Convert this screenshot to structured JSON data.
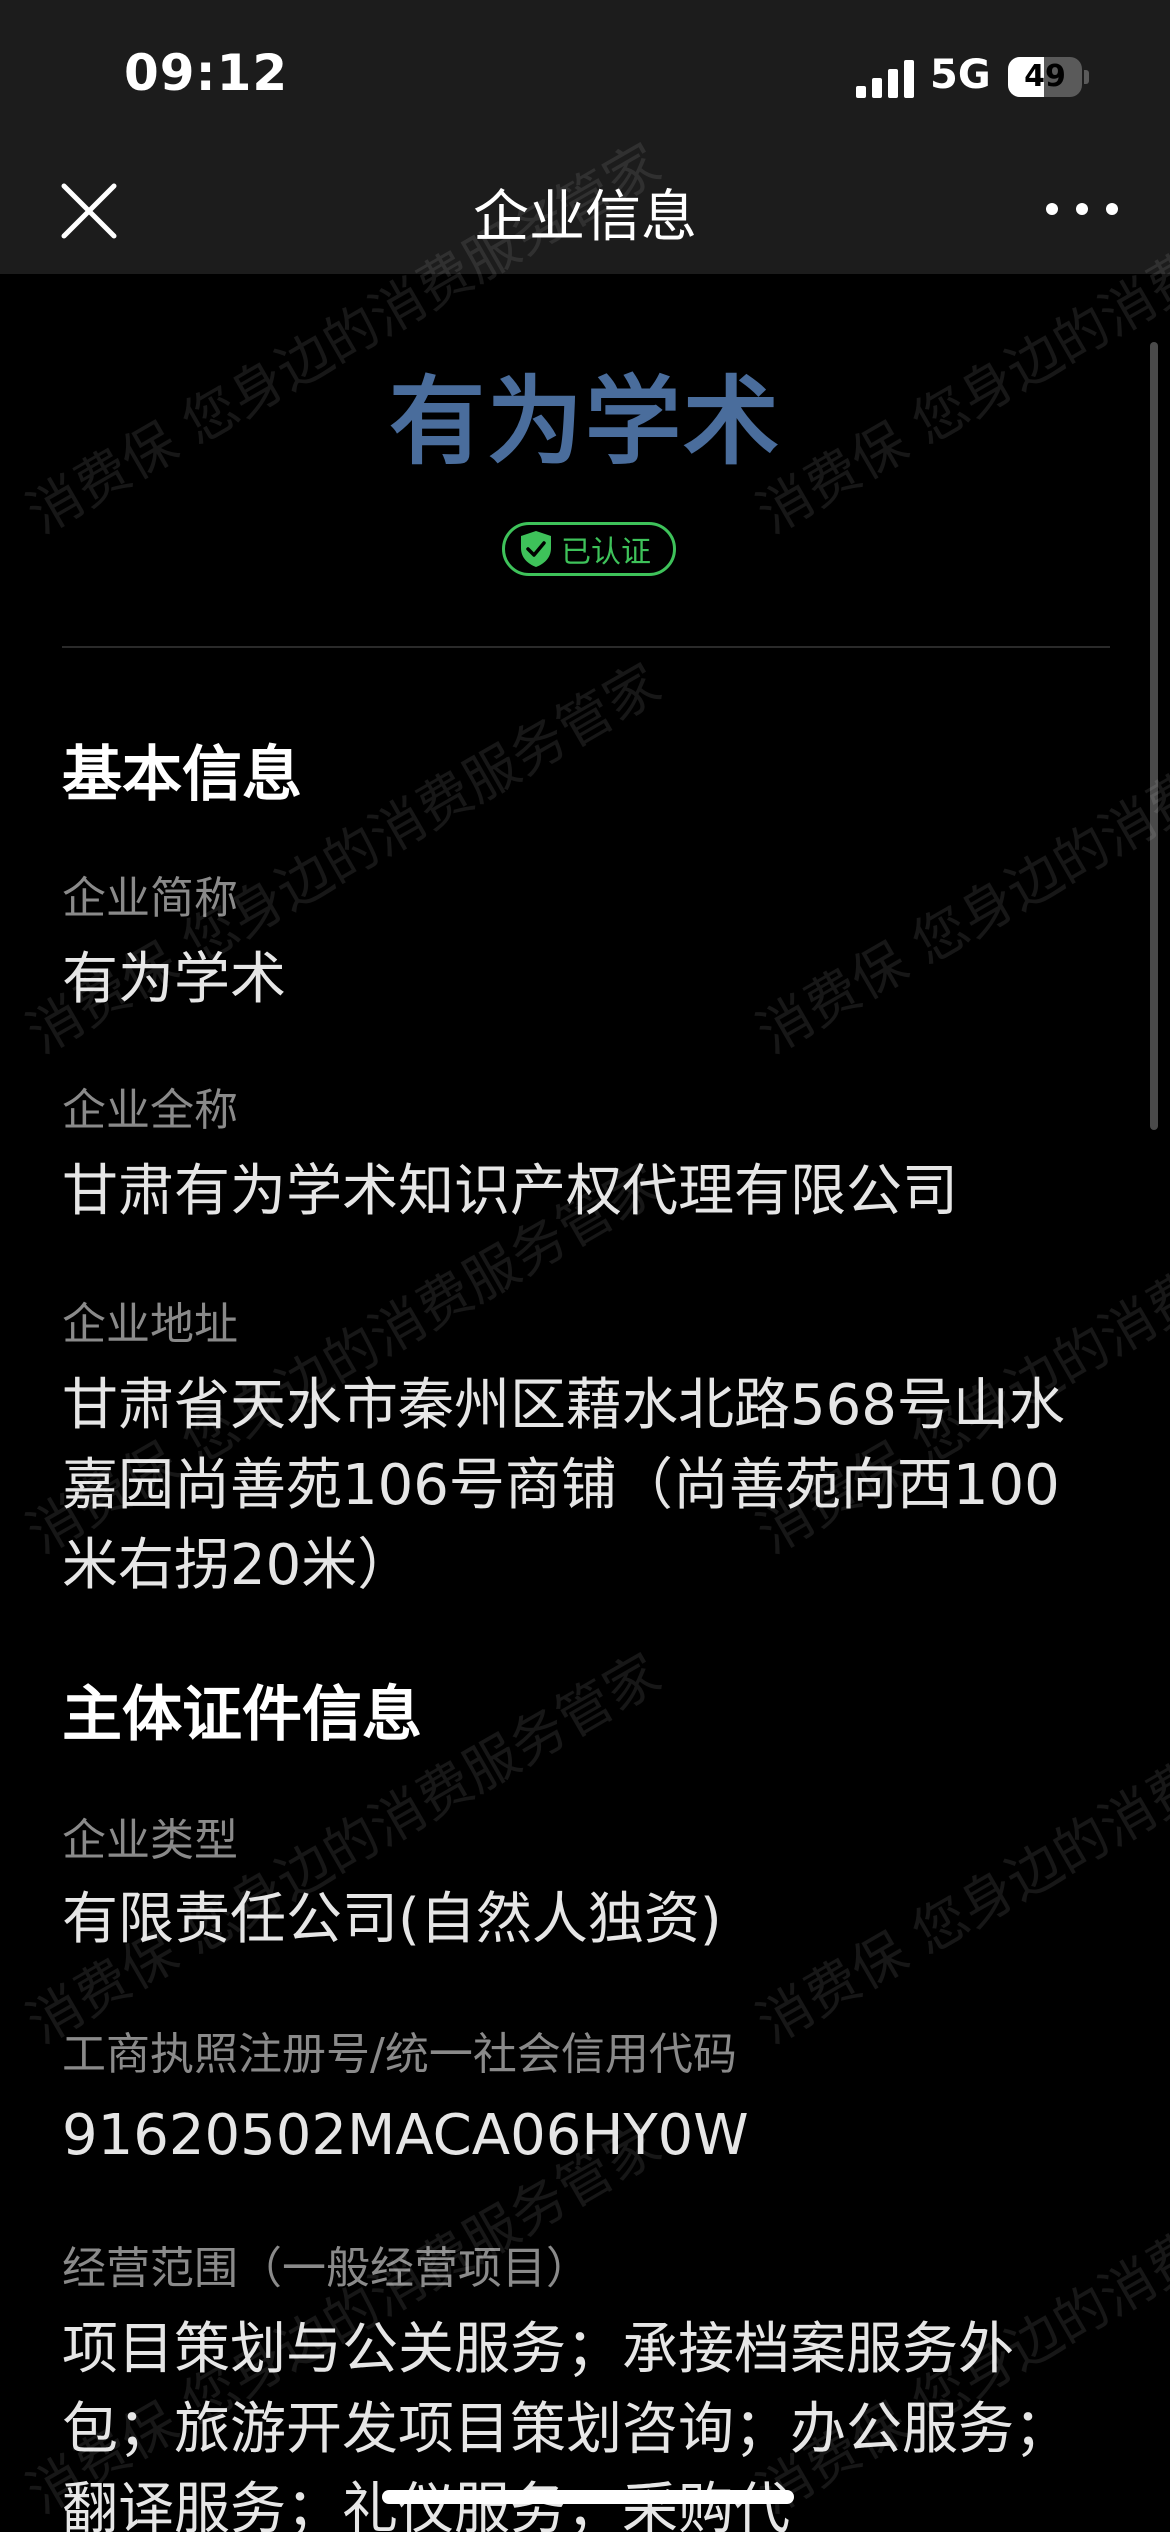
{
  "status_bar": {
    "time": "09:12",
    "network": "5G",
    "battery_percent": "49",
    "battery_level": 0.49,
    "signal_icon": "cellular-signal-icon"
  },
  "nav": {
    "title": "企业信息",
    "close_icon": "close-icon",
    "more_icon": "more-icon"
  },
  "company": {
    "display_name": "有为学术",
    "verified_label": "已认证",
    "verified_icon": "shield-check-icon",
    "verified_color": "#3ec25a",
    "title_color": "#4a6d9c"
  },
  "basic_info": {
    "title": "基本信息",
    "fields": [
      {
        "label": "企业简称",
        "value": "有为学术"
      },
      {
        "label": "企业全称",
        "value": "甘肃有为学术知识产权代理有限公司"
      },
      {
        "label": "企业地址",
        "value": "甘肃省天水市秦州区藉水北路568号山水嘉园尚善苑106号商铺（尚善苑向西100米右拐20米）"
      }
    ]
  },
  "license_info": {
    "title": "主体证件信息",
    "fields": [
      {
        "label": "企业类型",
        "value": "有限责任公司(自然人独资)"
      },
      {
        "label": "工商执照注册号/统一社会信用代码",
        "value": "91620502MACA06HY0W"
      },
      {
        "label": "经营范围（一般经营项目）",
        "value": "项目策划与公关服务；承接档案服务外包；旅游开发项目策划咨询；办公服务；翻译服务；礼仪服务；采购代"
      }
    ]
  },
  "watermark_text": "消费保 您身边的消费服务管家"
}
